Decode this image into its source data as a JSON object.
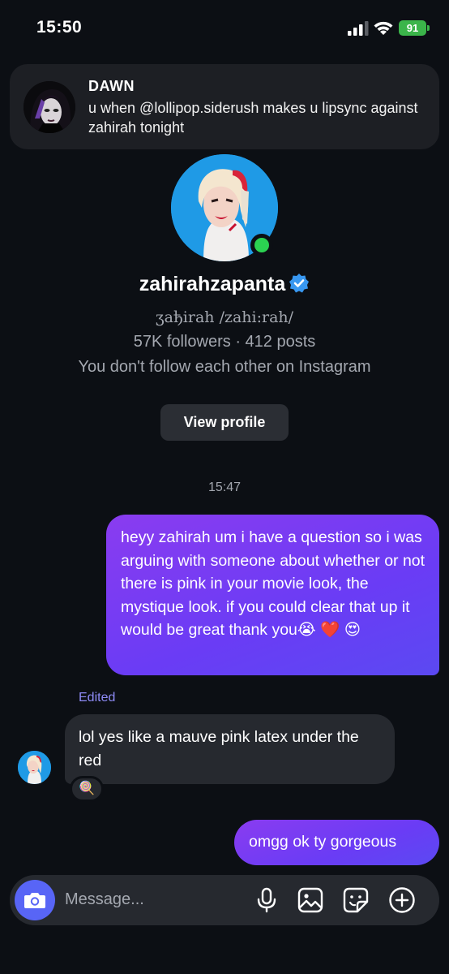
{
  "status_bar": {
    "time": "15:50",
    "battery": "91"
  },
  "notification": {
    "sender": "DAWN",
    "message": "u when @lollipop.siderush makes u lipsync against zahirah tonight"
  },
  "profile": {
    "username": "zahirahzapanta",
    "name_line": "ʒaђirah /zahi:rah/",
    "stats": "57K followers · 412 posts",
    "follow_status": "You don't follow each other on Instagram",
    "view_profile_label": "View profile"
  },
  "thread": {
    "timestamp": "15:47",
    "messages": [
      {
        "from": "me",
        "text": "heyy zahirah um i have a question so i was arguing with someone about whether or not there is pink in your movie look, the mystique look. if you could clear that up it would be great thank you😭 ❤️ 😍"
      },
      {
        "from": "them",
        "edited_label": "Edited",
        "text": "lol yes like a mauve pink latex under the red",
        "reaction": "🍭"
      },
      {
        "from": "me",
        "text": "omgg ok ty gorgeous"
      }
    ]
  },
  "composer": {
    "placeholder": "Message..."
  },
  "icons": [
    "signal-icon",
    "wifi-icon",
    "verified-badge-icon",
    "camera-icon",
    "microphone-icon",
    "gallery-icon",
    "sticker-icon",
    "plus-icon"
  ],
  "colors": {
    "background": "#0c0f14",
    "outgoing_bubble": "#7a3df3",
    "incoming_bubble": "#26292f",
    "accent": "#5865f6",
    "verified": "#3897f0",
    "online": "#2bd151"
  }
}
